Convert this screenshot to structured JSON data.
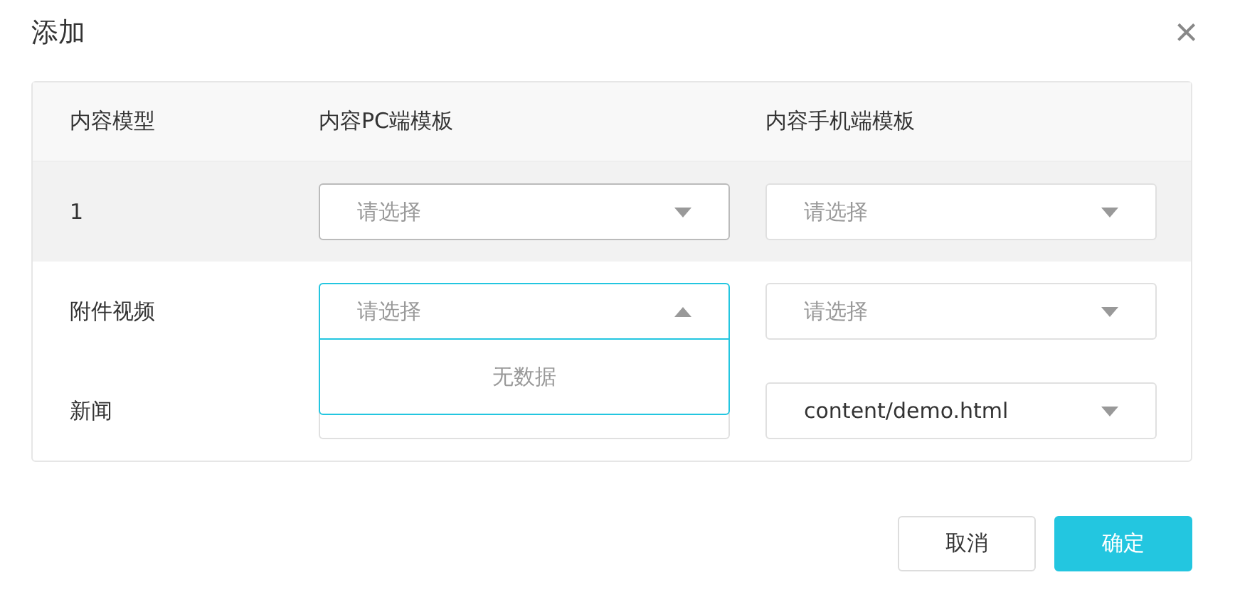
{
  "dialog": {
    "title": "添加",
    "close": "×"
  },
  "table": {
    "columns": [
      "内容模型",
      "内容PC端模板",
      "内容手机端模板"
    ],
    "rows": [
      {
        "model": "1",
        "highlighted": true,
        "pc": {
          "placeholder": "请选择",
          "open": false,
          "hovered": true
        },
        "mobile": {
          "placeholder": "请选择",
          "open": false,
          "hovered": false
        }
      },
      {
        "model": "附件视频",
        "highlighted": false,
        "pc": {
          "placeholder": "请选择",
          "open": true,
          "hovered": false,
          "empty_text": "无数据"
        },
        "mobile": {
          "placeholder": "请选择",
          "open": false,
          "hovered": false
        }
      },
      {
        "model": "新闻",
        "highlighted": false,
        "pc": {
          "open": false,
          "hovered": false
        },
        "mobile": {
          "value": "content/demo.html",
          "open": false,
          "hovered": false
        }
      }
    ]
  },
  "buttons": [
    {
      "label": "取消",
      "kind": "default"
    },
    {
      "label": "确定",
      "kind": "primary"
    }
  ]
}
